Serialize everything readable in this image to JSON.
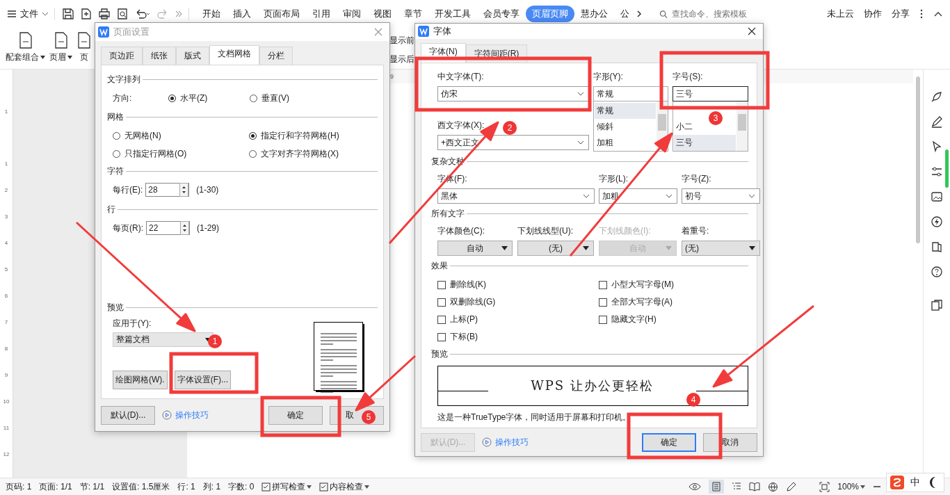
{
  "top_bar": {
    "menu": "文件",
    "tabs": [
      {
        "label": "开始",
        "selected": false
      },
      {
        "label": "插入",
        "selected": false
      },
      {
        "label": "页面布局",
        "selected": false
      },
      {
        "label": "引用",
        "selected": false
      },
      {
        "label": "审阅",
        "selected": false
      },
      {
        "label": "视图",
        "selected": false
      },
      {
        "label": "章节",
        "selected": false
      },
      {
        "label": "开发工具",
        "selected": false
      },
      {
        "label": "会员专享",
        "selected": false
      },
      {
        "label": "页眉页脚",
        "selected": true
      },
      {
        "label": "慧办公",
        "selected": false
      },
      {
        "label": "公",
        "selected": false
      }
    ],
    "search": {
      "placeholder": "查找命令、搜索模板"
    },
    "actions": [
      "未上云",
      "协作",
      "分享"
    ]
  },
  "ribbon": {
    "buttons": [
      {
        "label": "配套组合",
        "dropdown": true
      },
      {
        "label": "页眉",
        "dropdown": true
      },
      {
        "label": "页",
        "dropdown": false
      }
    ],
    "side_labels": [
      "显示前",
      "显示后"
    ]
  },
  "h_ruler": [
    "9"
  ],
  "v_ruler": [
    "1",
    "1",
    "2",
    "3",
    "4",
    "5",
    "6",
    "7",
    "8",
    "9",
    "10",
    "11",
    "12"
  ],
  "page_setup": {
    "title": "页面设置",
    "tabs": [
      {
        "label": "页边距",
        "selected": false
      },
      {
        "label": "纸张",
        "selected": false
      },
      {
        "label": "版式",
        "selected": false
      },
      {
        "label": "文档网格",
        "selected": true
      },
      {
        "label": "分栏",
        "selected": false
      }
    ],
    "direction": {
      "label": "文字排列",
      "field_label": "方向:",
      "options": [
        {
          "label": "水平(Z)",
          "selected": true
        },
        {
          "label": "垂直(V)",
          "selected": false
        }
      ]
    },
    "grid": {
      "label": "网格",
      "options": [
        {
          "label": "无网格(N)",
          "selected": false
        },
        {
          "label": "指定行和字符网格(H)",
          "selected": true
        },
        {
          "label": "只指定行网格(O)",
          "selected": false
        },
        {
          "label": "文字对齐字符网格(X)",
          "selected": false
        }
      ]
    },
    "spinners": [
      {
        "label": "字符",
        "field_label": "每行(E):",
        "value": "28",
        "range": "(1-30)"
      },
      {
        "label": "行",
        "field_label": "每页(R):",
        "value": "22",
        "range": "(1-29)"
      }
    ],
    "preview": {
      "label": "预览",
      "apply_label": "应用于(Y):",
      "apply_value": "整篇文档",
      "buttons": [
        "绘图网格(W).",
        "字体设置(F)..."
      ]
    },
    "footer": {
      "default": {
        "label": "默认(D)...",
        "disabled": false
      },
      "tips": "操作技巧",
      "ok": "确定",
      "cancel": "取"
    }
  },
  "font_dialog": {
    "title": "字体",
    "tabs": [
      {
        "label": "字体(N)",
        "selected": true
      },
      {
        "label": "字符间距(R)",
        "selected": false
      }
    ],
    "chinese_font": {
      "label": "中文字体(T):",
      "value": "仿宋"
    },
    "western_font": {
      "label": "西文字体(X):",
      "value": "+西文正文"
    },
    "style": {
      "label": "字形(Y):",
      "value": "常规",
      "options": [
        {
          "label": "常规",
          "selected": true
        },
        {
          "label": "倾斜",
          "selected": false
        },
        {
          "label": "加粗",
          "selected": false
        }
      ]
    },
    "size": {
      "label": "字号(S):",
      "value": "三号",
      "options": [
        {
          "label": "小二",
          "selected": false
        },
        {
          "label": "三号",
          "selected": true
        }
      ]
    },
    "complex": {
      "label": "复杂文种",
      "fields": [
        {
          "label": "字体(F):",
          "value": "黑体"
        },
        {
          "label": "字形(L):",
          "value": "加粗"
        },
        {
          "label": "字号(Z):",
          "value": "初号"
        }
      ]
    },
    "all_text": {
      "label": "所有文字",
      "fields": [
        {
          "label": "字体颜色(C):",
          "value": "自动",
          "disabled": false
        },
        {
          "label": "下划线线型(U):",
          "value": "(无)",
          "disabled": false
        },
        {
          "label": "下划线颜色(I):",
          "value": "自动",
          "disabled": true
        },
        {
          "label": "着重号:",
          "value": "(无)",
          "disabled": false
        }
      ]
    },
    "effects": {
      "label": "效果",
      "options": [
        {
          "label": "删除线(K)",
          "checked": false
        },
        {
          "label": "小型大写字母(M)",
          "checked": false
        },
        {
          "label": "双删除线(G)",
          "checked": false
        },
        {
          "label": "全部大写字母(A)",
          "checked": false
        },
        {
          "label": "上标(P)",
          "checked": false
        },
        {
          "label": "隐藏文字(H)",
          "checked": false
        },
        {
          "label": "下标(B)",
          "checked": false
        }
      ]
    },
    "preview": {
      "label": "预览",
      "sample": "WPS 让办公更轻松",
      "note": "这是一种TrueType字体，同时适用于屏幕和打印机。"
    },
    "footer": {
      "default": {
        "label": "默认(D)...",
        "disabled": true
      },
      "tips": "操作技巧",
      "ok": "确定",
      "cancel": "取消"
    }
  },
  "annotations": [
    {
      "label": "1"
    },
    {
      "label": "2"
    },
    {
      "label": "3"
    },
    {
      "label": "4"
    },
    {
      "label": "5"
    }
  ],
  "status_bar": {
    "items": [
      "页码: 1",
      "页面: 1/1",
      "节: 1/1",
      "设置值: 1.5厘米",
      "行: 1",
      "列: 1",
      "字数: 0"
    ],
    "tools": [
      "拼写检查",
      "内容检查"
    ],
    "zoom": "100%",
    "ime": "中"
  }
}
